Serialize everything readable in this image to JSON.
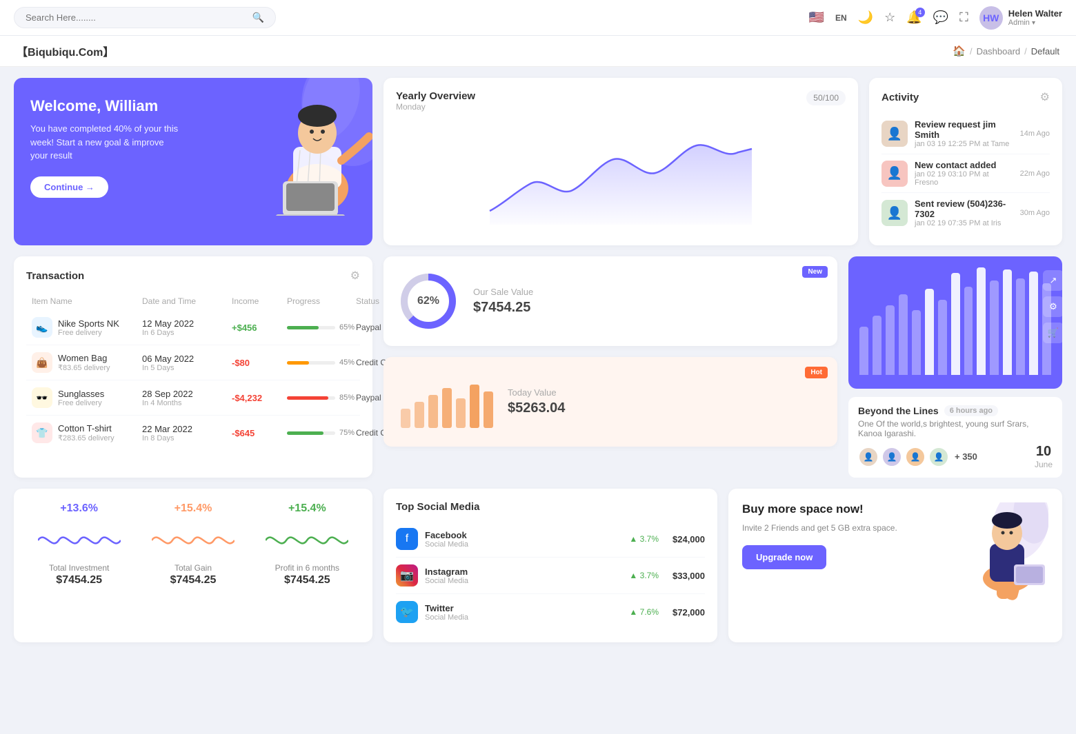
{
  "topnav": {
    "search_placeholder": "Search Here........",
    "lang": "EN",
    "notification_count": "4",
    "user_name": "Helen Walter",
    "user_role": "Admin"
  },
  "breadcrumb": {
    "brand": "【Biqubiqu.Com】",
    "home": "🏠",
    "separator": "/",
    "dashboard": "Dashboard",
    "current": "Default"
  },
  "welcome": {
    "title": "Welcome, William",
    "text": "You have completed 40% of your this week! Start a new goal & improve your result",
    "btn": "Continue →"
  },
  "yearly_overview": {
    "title": "Yearly Overview",
    "day": "Monday",
    "badge": "50/100"
  },
  "activity": {
    "title": "Activity",
    "items": [
      {
        "name": "Review request jim Smith",
        "date": "jan 03 19 12:25 PM at Tame",
        "time": "14m Ago",
        "color": "#e8d5c4"
      },
      {
        "name": "New contact added",
        "date": "jan 02 19 03:10 PM at Fresno",
        "time": "22m Ago",
        "color": "#f7c5c0"
      },
      {
        "name": "Sent review (504)236-7302",
        "date": "jan 02 19 07:35 PM at Iris",
        "time": "30m Ago",
        "color": "#d4e8d4"
      }
    ]
  },
  "transaction": {
    "title": "Transaction",
    "columns": [
      "Item Name",
      "Date and Time",
      "Income",
      "Progress",
      "Status"
    ],
    "rows": [
      {
        "name": "Nike Sports NK",
        "sub": "Free delivery",
        "date": "12 May 2022",
        "days": "In 6 Days",
        "income": "+$456",
        "income_type": "pos",
        "progress": 65,
        "status": "Paypal",
        "icon": "👟",
        "icon_bg": "#e8f4ff"
      },
      {
        "name": "Women Bag",
        "sub": "₹83.65 delivery",
        "date": "06 May 2022",
        "days": "In 5 Days",
        "income": "-$80",
        "income_type": "neg",
        "progress": 45,
        "status": "Credit Card",
        "icon": "👜",
        "icon_bg": "#fff0e8"
      },
      {
        "name": "Sunglasses",
        "sub": "Free delivery",
        "date": "28 Sep 2022",
        "days": "In 4 Months",
        "income": "-$4,232",
        "income_type": "neg",
        "progress": 85,
        "status": "Paypal",
        "icon": "🕶️",
        "icon_bg": "#fff8e0"
      },
      {
        "name": "Cotton T-shirt",
        "sub": "₹283.65 delivery",
        "date": "22 Mar 2022",
        "days": "In 8 Days",
        "income": "-$645",
        "income_type": "neg",
        "progress": 75,
        "status": "Credit Card",
        "icon": "👕",
        "icon_bg": "#ffe8e8"
      }
    ]
  },
  "sale_value": {
    "badge": "New",
    "percent": "62%",
    "label": "Our Sale Value",
    "value": "$7454.25"
  },
  "today_value": {
    "badge": "Hot",
    "label": "Today Value",
    "value": "$5263.04"
  },
  "bar_chart": {
    "bars": [
      40,
      55,
      65,
      80,
      70,
      90,
      75,
      100,
      85,
      110,
      95,
      120,
      105,
      130,
      115
    ],
    "beyond": {
      "title": "Beyond the Lines",
      "time_ago": "6 hours ago",
      "desc": "One Of the world,s brightest, young surf Srars, Kanoa Igarashi.",
      "count": "+ 350",
      "date_num": "10",
      "date_month": "June"
    }
  },
  "stats": [
    {
      "percent": "+13.6%",
      "color": "#6c63ff",
      "label": "Total Investment",
      "value": "$7454.25"
    },
    {
      "percent": "+15.4%",
      "color": "#ff9966",
      "label": "Total Gain",
      "value": "$7454.25"
    },
    {
      "percent": "+15.4%",
      "color": "#4caf50",
      "label": "Profit in 6 months",
      "value": "$7454.25"
    }
  ],
  "social_media": {
    "title": "Top Social Media",
    "items": [
      {
        "name": "Facebook",
        "type": "Social Media",
        "pct": "3.7%",
        "value": "$24,000",
        "icon": "f",
        "icon_bg": "#1877f2",
        "icon_color": "#fff"
      },
      {
        "name": "Instagram",
        "type": "Social Media",
        "pct": "3.7%",
        "value": "$33,000",
        "icon": "📷",
        "icon_bg": "#e1306c",
        "icon_color": "#fff"
      },
      {
        "name": "Twitter",
        "type": "Social Media",
        "pct": "7.6%",
        "value": "$72,000",
        "icon": "🐦",
        "icon_bg": "#1da1f2",
        "icon_color": "#fff"
      }
    ]
  },
  "buy_space": {
    "title": "Buy more space now!",
    "desc": "Invite 2 Friends and get 5 GB extra space.",
    "btn": "Upgrade now"
  }
}
